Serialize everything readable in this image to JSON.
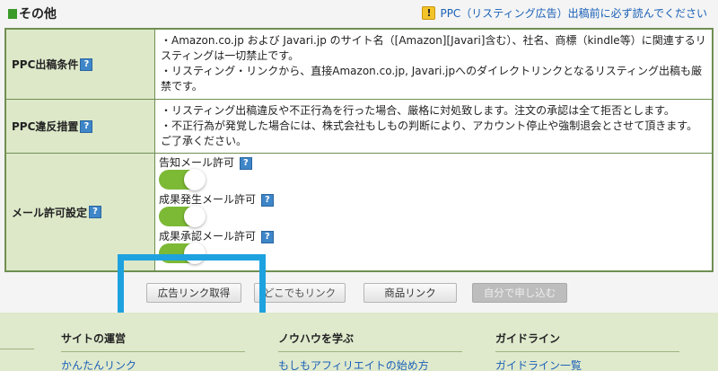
{
  "section": {
    "title": "その他",
    "ppc_notice": "PPC（リスティング広告）出稿前に必ず読んでください",
    "warning_glyph": "!"
  },
  "rows": {
    "ppc_conditions": {
      "label": "PPC出稿条件",
      "lines": [
        "・Amazon.co.jp および Javari.jp のサイト名（[Amazon][Javari]含む）、社名、商標（kindle等）に関連するリスティングは一切禁止です。",
        "・リスティング・リンクから、直接Amazon.co.jp, Javari.jpへのダイレクトリンクとなるリスティング出稿も厳禁です。"
      ]
    },
    "ppc_violation": {
      "label": "PPC違反措置",
      "lines": [
        "・リスティング出稿違反や不正行為を行った場合、厳格に対処致します。注文の承認は全て拒否とします。",
        "・不正行為が発覚した場合には、株式会社もしもの判断により、アカウント停止や強制退会とさせて頂きます。ご了承ください。"
      ]
    },
    "mail_settings": {
      "label": "メール許可設定",
      "items": [
        {
          "label": "告知メール許可",
          "enabled": true
        },
        {
          "label": "成果発生メール許可",
          "enabled": true
        },
        {
          "label": "成果承認メール許可",
          "enabled": true
        }
      ]
    }
  },
  "help_glyph": "?",
  "buttons": {
    "get_link": "広告リンク取得",
    "anywhere_link": "どこでもリンク",
    "product_link": "商品リンク",
    "self_apply": "自分で申し込む"
  },
  "footer": {
    "columns": [
      {
        "title": "サイトの運営",
        "link": "かんたんリンク"
      },
      {
        "title": "ノウハウを学ぶ",
        "link": "もしもアフィリエイトの始め方"
      },
      {
        "title": "ガイドライン",
        "link": "ガイドライン一覧"
      }
    ]
  },
  "colors": {
    "accent_green": "#3a9a2a",
    "table_border": "#6f8f52",
    "label_bg": "#dde8c9",
    "toggle_on": "#7cb935",
    "link_blue": "#1b61b8",
    "highlight_blue": "#1ea2df",
    "footer_bg": "#dfe9cc"
  }
}
